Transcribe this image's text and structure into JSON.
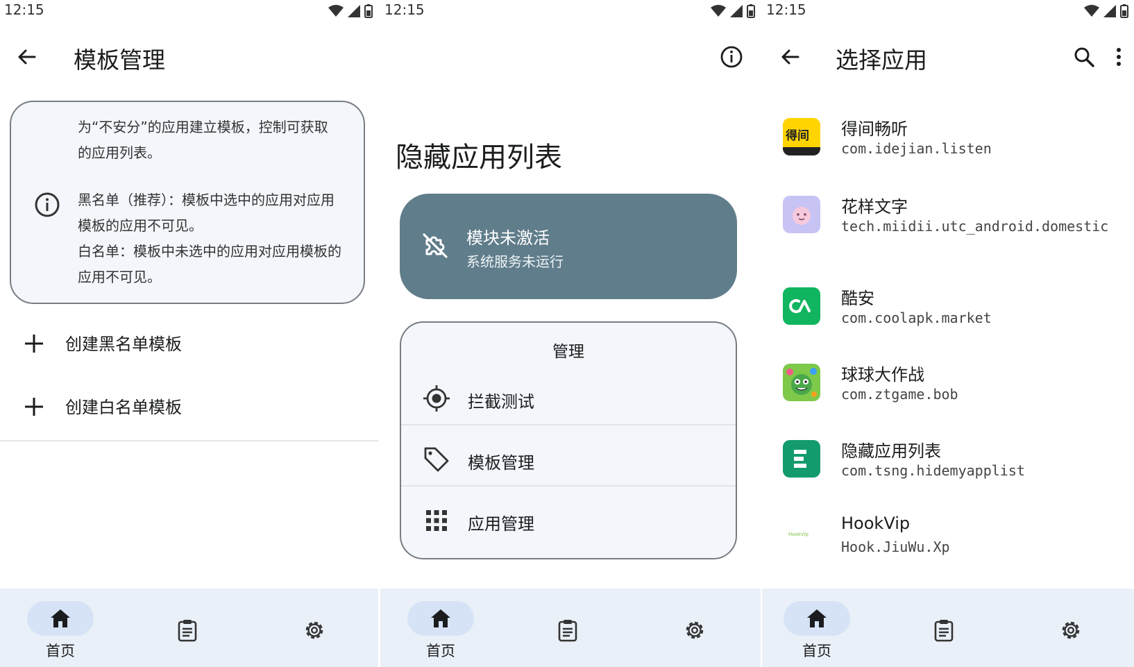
{
  "statusbar": {
    "time": "12:15"
  },
  "screen1": {
    "title": "模板管理",
    "info": {
      "p1": "为“不安分”的应用建立模板，控制可获取的应用列表。",
      "p2a": "黑名单（推荐）：模板中选中的应用对应用模板的应用不可见。",
      "p2b": "白名单：模板中未选中的应用对应用模板的应用不可见。"
    },
    "actions": [
      {
        "label": "创建黑名单模板"
      },
      {
        "label": "创建白名单模板"
      }
    ]
  },
  "screen2": {
    "heading": "隐藏应用列表",
    "status": {
      "title": "模块未激活",
      "subtitle": "系统服务未运行"
    },
    "manage": {
      "title": "管理",
      "items": [
        {
          "label": "拦截测试",
          "icon": "target-icon"
        },
        {
          "label": "模板管理",
          "icon": "tag-icon"
        },
        {
          "label": "应用管理",
          "icon": "apps-grid-icon"
        }
      ]
    }
  },
  "screen3": {
    "title": "选择应用",
    "apps": [
      {
        "name": "得间畅听",
        "package": "com.idejian.listen",
        "icon_text": "得间"
      },
      {
        "name": "花样文字",
        "package": "tech.miidii.utc_android.domestic"
      },
      {
        "name": "酷安",
        "package": "com.coolapk.market"
      },
      {
        "name": "球球大作战",
        "package": "com.ztgame.bob"
      },
      {
        "name": "隐藏应用列表",
        "package": "com.tsng.hidemyapplist"
      },
      {
        "name": "HookVip",
        "package": "Hook.JiuWu.Xp",
        "icon_text": "HookVip"
      }
    ]
  },
  "nav": {
    "home": "首页"
  },
  "colors": {
    "accent_card": "#607d8b",
    "nav_bg": "#eaf0f8",
    "nav_pill": "#d6e3f6",
    "card_bg": "#f3f6fb"
  }
}
